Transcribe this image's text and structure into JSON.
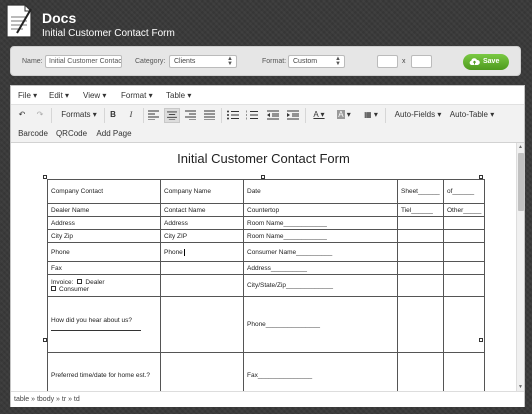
{
  "header": {
    "app_title": "Docs",
    "document_title": "Initial Customer Contact Form"
  },
  "settings": {
    "name_label": "Name:",
    "name_value": "Initial Customer Contac",
    "category_label": "Category:",
    "category_value": "Clients",
    "format_label": "Format:",
    "format_value": "Custom",
    "size_separator": "x",
    "width_value": "",
    "height_value": "",
    "save_label": "Save"
  },
  "menubar": {
    "items": [
      "File",
      "Edit",
      "View",
      "Format",
      "Table"
    ]
  },
  "toolbar": {
    "formats_label": "Formats",
    "bold_label": "B",
    "italic_label": "I",
    "auto_fields_label": "Auto-Fields",
    "auto_table_label": "Auto-Table",
    "barcode_label": "Barcode",
    "qrcode_label": "QRCode",
    "add_page_label": "Add Page"
  },
  "icons": {
    "undo": "undo-icon",
    "redo": "redo-icon",
    "align": "align-icons",
    "list": "list-icons",
    "table": "table-icon"
  },
  "form": {
    "title": "Initial Customer Contact Form",
    "rows": [
      [
        "Company Contact",
        "Company Name",
        "Date",
        "Sheet______",
        "of______"
      ],
      [
        "Dealer Name",
        "Contact Name",
        "Countertop",
        "Tiel______",
        "Other_____"
      ],
      [
        "Address",
        "Address",
        "Room Name____________",
        "",
        ""
      ],
      [
        "City Zip",
        "City ZIP",
        "Room Name____________",
        "",
        ""
      ],
      [
        "Phone",
        "Phone",
        "Consumer    Name__________",
        "",
        ""
      ],
      [
        "Fax",
        "",
        "Address__________",
        "",
        ""
      ],
      [
        "",
        "",
        "City/State/Zip_____________",
        "",
        ""
      ],
      [
        "How did you hear about us?",
        "",
        "Phone_______________",
        "",
        ""
      ],
      [
        "Preferred time/date for home est.?",
        "",
        "Fax_______________",
        "",
        ""
      ]
    ],
    "invoice_label": "Invoice:",
    "dealer_option": "Dealer",
    "consumer_option": "Consumer"
  },
  "statusbar": {
    "path": "table » tbody » tr » td"
  },
  "colors": {
    "save_green": "#5aa92a",
    "background": "#3a3a3a"
  }
}
